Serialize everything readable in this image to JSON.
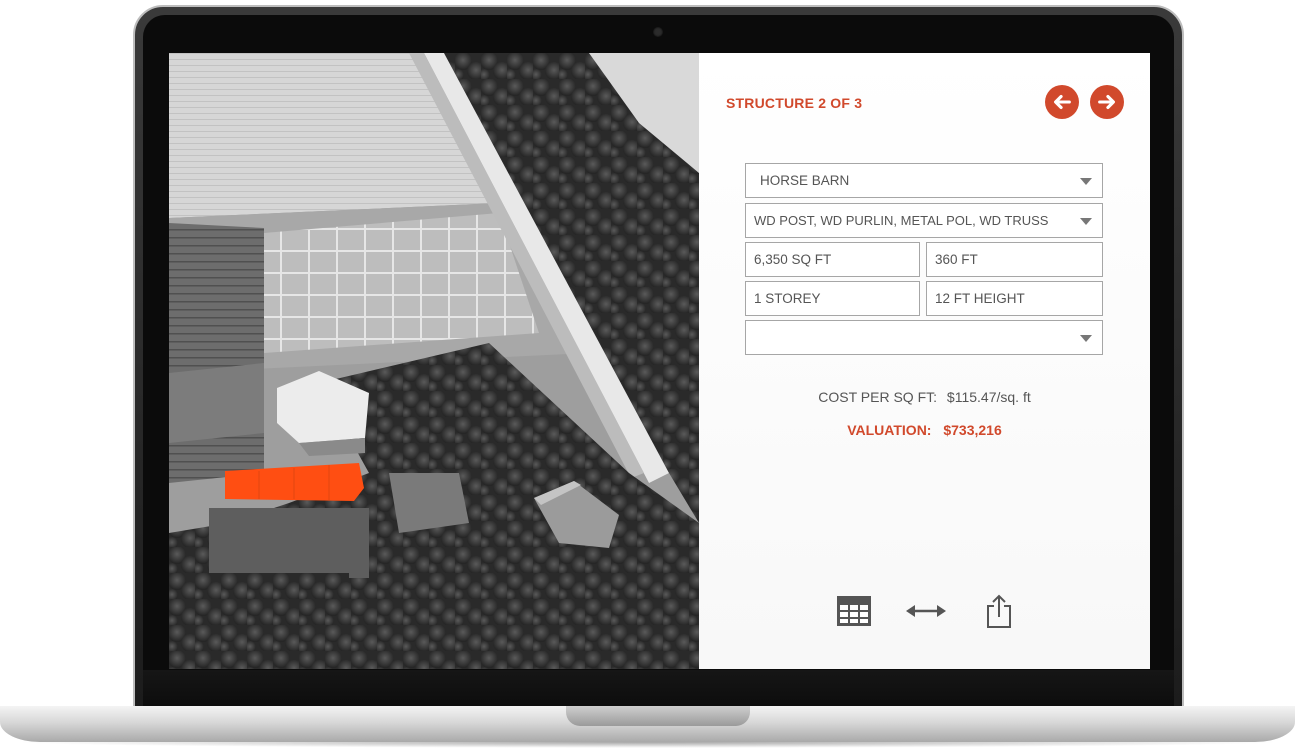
{
  "panel": {
    "structure_title": "STRUCTURE 2 OF 3",
    "accent_color": "#d1492c",
    "nav": {
      "prev_icon": "arrow-left-circle-icon",
      "next_icon": "arrow-right-circle-icon"
    }
  },
  "form": {
    "structure_type": "HORSE BARN",
    "construction": "WD POST, WD PURLIN, METAL POL, WD TRUSS",
    "area": "6,350 SQ FT",
    "perimeter": "360 FT",
    "storeys": "1 STOREY",
    "height": "12 FT HEIGHT",
    "extra_select": ""
  },
  "results": {
    "cost_label": "COST PER SQ FT:",
    "cost_value": "$115.47/sq. ft",
    "valuation_label": "VALUATION:",
    "valuation_value": "$733,216"
  },
  "toolbar": {
    "icons": [
      "table-icon",
      "resize-horizontal-icon",
      "share-icon"
    ]
  },
  "aerial": {
    "highlight_color": "#ff4e12"
  }
}
